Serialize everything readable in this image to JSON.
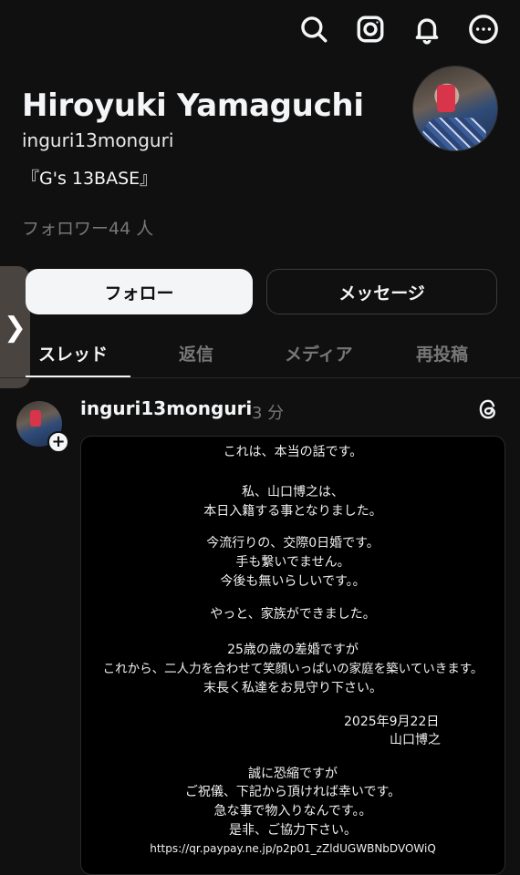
{
  "topbar": {
    "icons": [
      "search-icon",
      "instagram-icon",
      "bell-icon",
      "more-icon"
    ]
  },
  "profile": {
    "name": "Hiroyuki Yamaguchi",
    "handle": "inguri13monguri",
    "bio": "『G's 13BASE』",
    "followers": "フォロワー44 人"
  },
  "side_tab": {
    "glyph": "❯"
  },
  "actions": {
    "follow": "フォロー",
    "message": "メッセージ"
  },
  "tabs": [
    {
      "label": "スレッド",
      "active": true
    },
    {
      "label": "返信"
    },
    {
      "label": "メディア"
    },
    {
      "label": "再投稿"
    }
  ],
  "post": {
    "user": "inguri13monguri",
    "time": "3 分",
    "plus": "+",
    "image_lines": [
      "これは、本当の話です。",
      "私、山口博之は、",
      "本日入籍する事となりました。",
      "今流行りの、交際0日婚です。",
      "手も繋いでません。",
      "今後も無いらしいです。。",
      "やっと、家族ができました。",
      "25歳の歳の差婚ですが",
      "これから、二人力を合わせて笑顔いっぱいの家庭を築いていきます。",
      "末長く私達をお見守り下さい。",
      "2025年9月22日",
      "山口博之",
      "誠に恐縮ですが",
      "ご祝儀、下記から頂ければ幸いです。",
      "急な事で物入りなんです。。",
      "是非、ご協力下さい。",
      "https://qr.paypay.ne.jp/p2p01_zZldUGWBNbDVOWiQ"
    ]
  }
}
